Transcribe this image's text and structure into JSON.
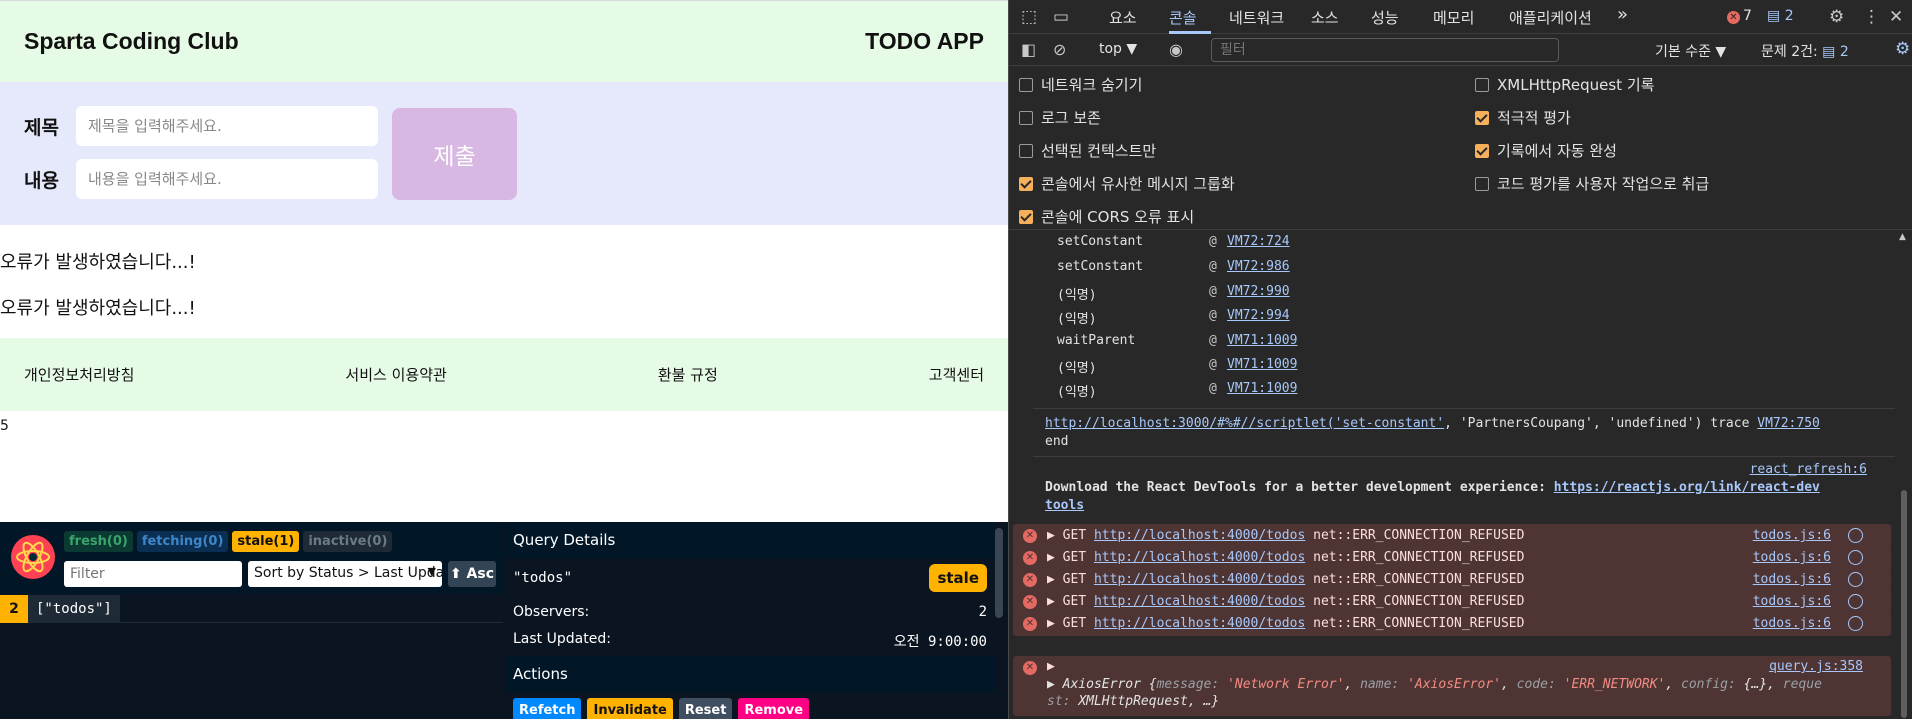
{
  "app": {
    "brand": "Sparta Coding Club",
    "title": "TODO APP",
    "form": {
      "title_label": "제목",
      "title_placeholder": "제목을 입력해주세요.",
      "content_label": "내용",
      "content_placeholder": "내용을 입력해주세요.",
      "submit_label": "제출"
    },
    "errors": [
      "오류가 발생하였습니다...!",
      "오류가 발생하였습니다...!"
    ],
    "footer": [
      "개인정보처리방침",
      "서비스 이용약관",
      "환불 규정",
      "고객센터"
    ],
    "stray_char": "5"
  },
  "rq_devtools": {
    "chips": {
      "fresh": "fresh(0)",
      "fetching": "fetching(0)",
      "stale": "stale(1)",
      "inactive": "inactive(0)"
    },
    "filter_placeholder": "Filter",
    "sort_label": "Sort by Status > Last Updated",
    "asc_label": "⬆ Asc",
    "query_row": {
      "count": "2",
      "key": "[\"todos\"]"
    },
    "details": {
      "heading": "Query Details",
      "query_key": "\"todos\"",
      "status_badge": "stale",
      "observers_label": "Observers:",
      "observers_value": "2",
      "last_updated_label": "Last Updated:",
      "last_updated_value": "오전 9:00:00"
    },
    "actions": {
      "heading": "Actions",
      "refetch": "Refetch",
      "invalidate": "Invalidate",
      "reset": "Reset",
      "remove": "Remove"
    }
  },
  "devtools": {
    "tabs": [
      "요소",
      "콘솔",
      "네트워크",
      "소스",
      "성능",
      "메모리",
      "애플리케이션"
    ],
    "more_tabs": "»",
    "error_count": "7",
    "message_count": "2",
    "context": "top",
    "filter_placeholder": "필터",
    "level": "기본 수준",
    "issues_label": "문제 2건:",
    "issues_count": "2",
    "options": [
      {
        "label": "네트워크 숨기기",
        "checked": false
      },
      {
        "label": "XMLHttpRequest 기록",
        "checked": false
      },
      {
        "label": "로그 보존",
        "checked": false
      },
      {
        "label": "적극적 평가",
        "checked": true
      },
      {
        "label": "선택된 컨텍스트만",
        "checked": false
      },
      {
        "label": "기록에서 자동 완성",
        "checked": true
      },
      {
        "label": "콘솔에서 유사한 메시지 그룹화",
        "checked": true
      },
      {
        "label": "코드 평가를 사용자 작업으로 취급",
        "checked": false
      },
      {
        "label": "콘솔에 CORS 오류 표시",
        "checked": true
      }
    ],
    "trace": [
      {
        "fn": "setConstant",
        "at": "@",
        "src": "VM72:724"
      },
      {
        "fn": "setConstant",
        "at": "@",
        "src": "VM72:986"
      },
      {
        "fn": "(익명)",
        "at": "@",
        "src": "VM72:990"
      },
      {
        "fn": "(익명)",
        "at": "@",
        "src": "VM72:994"
      },
      {
        "fn": "waitParent",
        "at": "@",
        "src": "VM71:1009"
      },
      {
        "fn": "(익명)",
        "at": "@",
        "src": "VM71:1009"
      },
      {
        "fn": "(익명)",
        "at": "@",
        "src": "VM71:1009"
      }
    ],
    "scriptlet": {
      "url": "http://localhost:3000/#%#//scriptlet('set-constant'",
      "rest": ", 'PartnersCoupang', 'undefined') trace",
      "src": "VM72:750",
      "end": "end"
    },
    "react_msg": {
      "src": "react_refresh:6",
      "text": "Download the React DevTools for a better development experience:",
      "link1": "https://reactjs.org/link/react-dev",
      "link2": "tools"
    },
    "net_errors": [
      {
        "method": "GET",
        "url": "http://localhost:4000/todos",
        "err": "net::ERR_CONNECTION_REFUSED",
        "src": "todos.js:6"
      },
      {
        "method": "GET",
        "url": "http://localhost:4000/todos",
        "err": "net::ERR_CONNECTION_REFUSED",
        "src": "todos.js:6"
      },
      {
        "method": "GET",
        "url": "http://localhost:4000/todos",
        "err": "net::ERR_CONNECTION_REFUSED",
        "src": "todos.js:6"
      },
      {
        "method": "GET",
        "url": "http://localhost:4000/todos",
        "err": "net::ERR_CONNECTION_REFUSED",
        "src": "todos.js:6"
      },
      {
        "method": "GET",
        "url": "http://localhost:4000/todos",
        "err": "net::ERR_CONNECTION_REFUSED",
        "src": "todos.js:6"
      }
    ],
    "axios": {
      "src": "query.js:358",
      "name": "AxiosError",
      "k1": "message:",
      "v1": "'Network Error'",
      "k2": "name:",
      "v2": "'AxiosError'",
      "k3": "code:",
      "v3": "'ERR_NETWORK'",
      "k4": "config:",
      "v4": "{…}",
      "k5": "reque",
      "k6": "st:",
      "v6": "XMLHttpRequest, …}"
    }
  }
}
